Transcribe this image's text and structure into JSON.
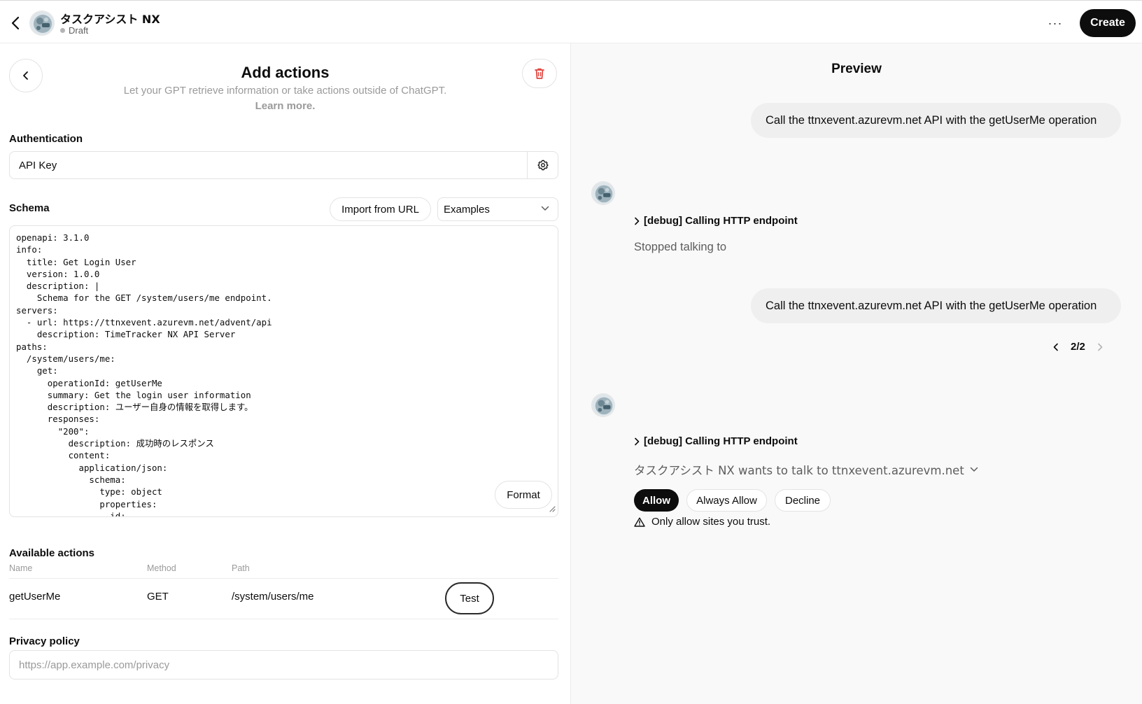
{
  "header": {
    "gpt_name": "タスクアシスト NX",
    "status": "Draft",
    "create_label": "Create",
    "more_label": "···"
  },
  "actions_panel": {
    "title": "Add actions",
    "subtitle": "Let your GPT retrieve information or take actions outside of ChatGPT.",
    "learn_more": "Learn more.",
    "authentication": {
      "label": "Authentication",
      "value": "API Key"
    },
    "schema": {
      "label": "Schema",
      "import_label": "Import from URL",
      "examples_label": "Examples",
      "format_label": "Format",
      "code": "openapi: 3.1.0\ninfo:\n  title: Get Login User\n  version: 1.0.0\n  description: |\n    Schema for the GET /system/users/me endpoint.\nservers:\n  - url: https://ttnxevent.azurevm.net/advent/api\n    description: TimeTracker NX API Server\npaths:\n  /system/users/me:\n    get:\n      operationId: getUserMe\n      summary: Get the login user information\n      description: ユーザー自身の情報を取得します。\n      responses:\n        \"200\":\n          description: 成功時のレスポンス\n          content:\n            application/json:\n              schema:\n                type: object\n                properties:\n                  id:"
    },
    "available_actions": {
      "label": "Available actions",
      "columns": [
        "Name",
        "Method",
        "Path"
      ],
      "rows": [
        {
          "name": "getUserMe",
          "method": "GET",
          "path": "/system/users/me",
          "test_label": "Test"
        }
      ]
    },
    "privacy_policy": {
      "label": "Privacy policy",
      "placeholder": "https://app.example.com/privacy"
    }
  },
  "preview": {
    "title": "Preview",
    "messages": {
      "user_1": "Call the ttnxevent.azurevm.net API with the getUserMe operation",
      "debug_1": "[debug] Calling HTTP endpoint",
      "bot_1": "Stopped talking to",
      "user_2": "Call the ttnxevent.azurevm.net API with the getUserMe operation",
      "pager": "2/2",
      "debug_2": "[debug] Calling HTTP endpoint",
      "wants_text": "タスクアシスト NX wants to talk to ttnxevent.azurevm.net",
      "allow_label": "Allow",
      "always_allow_label": "Always Allow",
      "decline_label": "Decline",
      "warning": "Only allow sites you trust."
    }
  },
  "colors": {
    "primary_button": "#0d0d0d",
    "delete_icon": "#e0443e",
    "preview_bg": "#f9f9f9",
    "user_bubble": "#efefef"
  },
  "icons": [
    "back-arrow-icon",
    "chevron-left-icon",
    "trash-icon",
    "gear-icon",
    "chevron-down-icon",
    "chevron-right-icon",
    "warning-triangle-icon",
    "more-icon"
  ]
}
